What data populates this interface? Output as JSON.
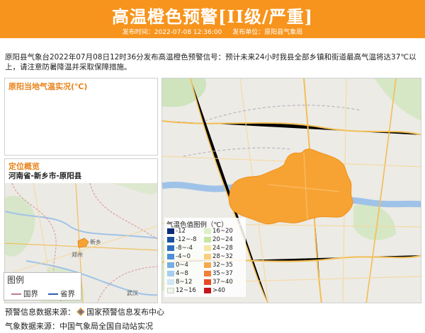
{
  "header": {
    "title": "高温橙色预警[II级/严重]",
    "issue_time": "发布时间：2022-07-08 12:36:00",
    "issuer": "发布单位：原阳县气象局"
  },
  "notice": "原阳县气象台2022年07月08日12时36分发布高温橙色预警信号：预计未来24小时我县全部乡镇和街道最高气温将达37℃以上，请注意防暑降温并采取保障措施。",
  "temp_panel": {
    "title": "原阳当地气温实况(℃)"
  },
  "location_panel": {
    "title": "定位概览",
    "path": "河南省-新乡市-原阳县",
    "map_labels": [
      "新乡",
      "郑州",
      "武汉"
    ]
  },
  "map_legend": {
    "title": "图例",
    "items": [
      {
        "label": "国界",
        "color": "#c07a8a"
      },
      {
        "label": "省界",
        "color": "#2d5fb0"
      }
    ]
  },
  "color_legend": {
    "title": "气温色值图例（℃）",
    "items": [
      {
        "label": "-12",
        "color": "#0b2a7a"
      },
      {
        "label": "-12~-8",
        "color": "#1b4fa0"
      },
      {
        "label": "-8~-4",
        "color": "#2f6fc2"
      },
      {
        "label": "-4~0",
        "color": "#4d8fd8"
      },
      {
        "label": "0~4",
        "color": "#78aee6"
      },
      {
        "label": "4~8",
        "color": "#a7cdef"
      },
      {
        "label": "8~12",
        "color": "#d2e6f5"
      },
      {
        "label": "12~16",
        "color": "#f0f6e6"
      },
      {
        "label": "16~20",
        "color": "#dff0c9"
      },
      {
        "label": "20~24",
        "color": "#c9e6a1"
      },
      {
        "label": "24~28",
        "color": "#f6e5a3"
      },
      {
        "label": "28~32",
        "color": "#f7cf7a"
      },
      {
        "label": "32~35",
        "color": "#f6a94f"
      },
      {
        "label": "35~37",
        "color": "#f27f3a"
      },
      {
        "label": "37~40",
        "color": "#e64b25"
      },
      {
        "label": ">40",
        "color": "#c4161c"
      }
    ]
  },
  "footer": {
    "warning_source_prefix": "预警信息数据来源：",
    "warning_source": "国家预警信息发布中心",
    "weather_source": "气象数据来源：中国气象局全国自动站实况"
  },
  "colors": {
    "accent": "#f7941d",
    "warning_area": "#f7a333",
    "panel_title": "#e8821a"
  }
}
